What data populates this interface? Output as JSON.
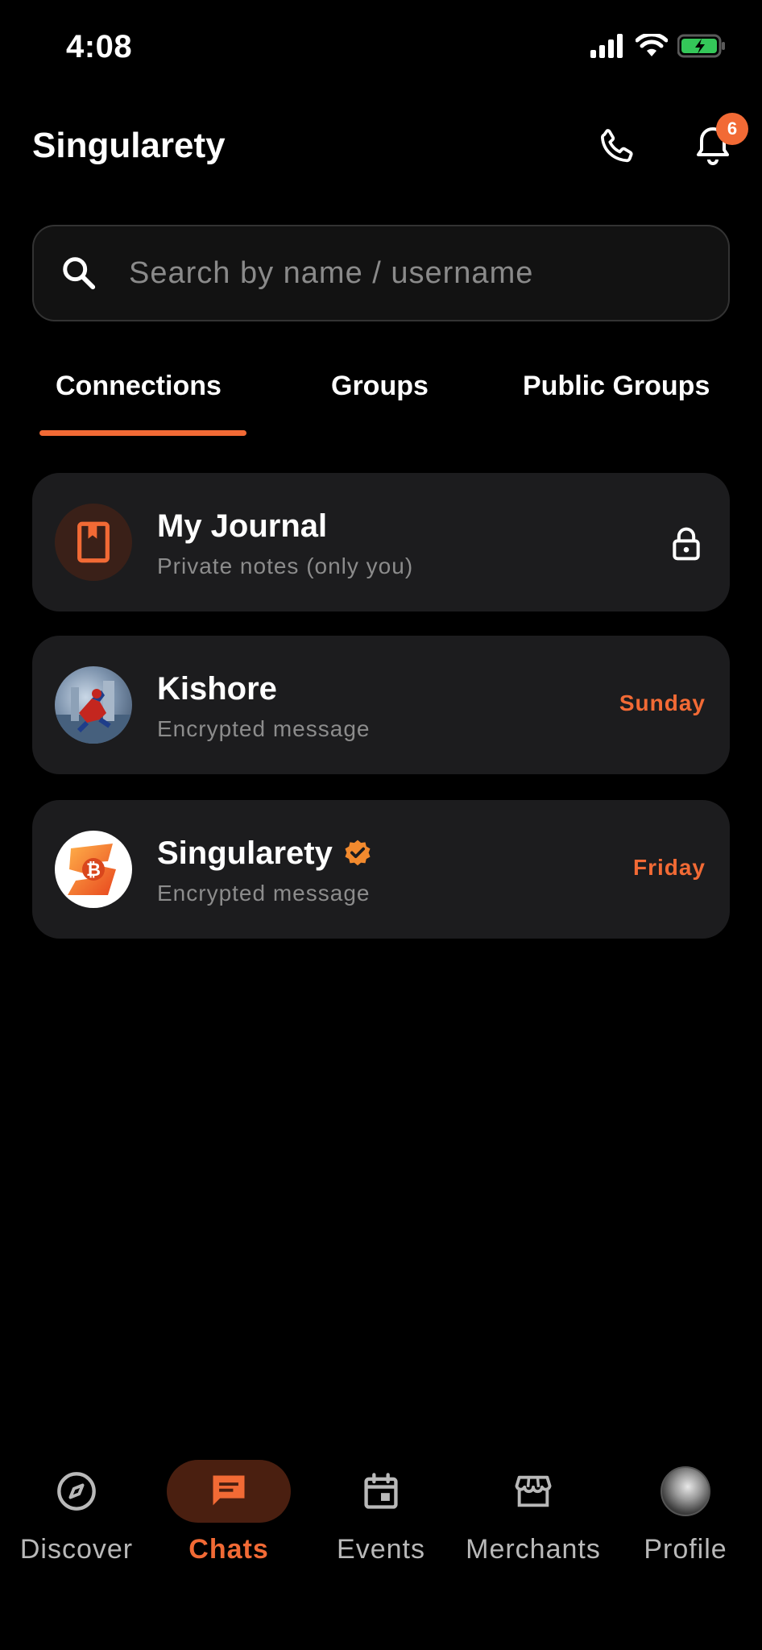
{
  "status_bar": {
    "time": "4:08"
  },
  "header": {
    "title": "Singularety",
    "notification_count": "6"
  },
  "search": {
    "placeholder": "Search by name / username"
  },
  "tabs": [
    {
      "label": "Connections",
      "active": true
    },
    {
      "label": "Groups",
      "active": false
    },
    {
      "label": "Public Groups",
      "active": false
    }
  ],
  "chats": [
    {
      "name": "My Journal",
      "subtitle": "Private notes (only you)",
      "trailing_icon": "lock-icon",
      "avatar_icon": "bookmark-icon"
    },
    {
      "name": "Kishore",
      "subtitle": "Encrypted message",
      "time": "Sunday"
    },
    {
      "name": "Singularety",
      "subtitle": "Encrypted message",
      "time": "Friday",
      "verified": true
    }
  ],
  "nav": [
    {
      "label": "Discover",
      "icon": "compass-icon",
      "active": false
    },
    {
      "label": "Chats",
      "icon": "chat-icon",
      "active": true
    },
    {
      "label": "Events",
      "icon": "calendar-icon",
      "active": false
    },
    {
      "label": "Merchants",
      "icon": "store-icon",
      "active": false
    },
    {
      "label": "Profile",
      "icon": "profile-avatar",
      "active": false
    }
  ],
  "colors": {
    "accent": "#f26a35",
    "background": "#000000",
    "card": "#1c1c1e",
    "muted_text": "#8c8c8c"
  }
}
